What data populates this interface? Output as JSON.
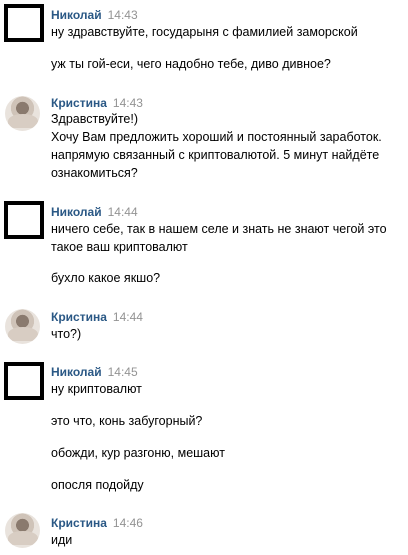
{
  "messages": [
    {
      "author": "Николай",
      "time": "14:43",
      "avatar": "blank-square-avatar",
      "lines": [
        "ну здравствуйте, государыня с фамилией заморской",
        "уж ты гой-еси, чего надобно тебе, диво дивное?"
      ]
    },
    {
      "author": "Кристина",
      "time": "14:43",
      "avatar": "photo-avatar",
      "lines": [
        "Здравствуйте!)",
        "Хочу Вам предложить хороший и постоянный заработок.",
        "напрямую связанный с криптовалютой. 5 минут найдёте",
        "ознакомиться?"
      ]
    },
    {
      "author": "Николай",
      "time": "14:44",
      "avatar": "blank-square-avatar",
      "lines": [
        "ничего себе, так в нашем селе и знать не знают чегой это",
        "такое ваш криптовалют",
        "бухло какое якшо?"
      ]
    },
    {
      "author": "Кристина",
      "time": "14:44",
      "avatar": "photo-avatar",
      "lines": [
        "что?)"
      ]
    },
    {
      "author": "Николай",
      "time": "14:45",
      "avatar": "blank-square-avatar",
      "lines": [
        "ну криптовалют",
        "это что, конь забугорный?",
        "обожди, кур разгоню, мешают",
        "опосля подойду"
      ]
    },
    {
      "author": "Кристина",
      "time": "14:46",
      "avatar": "photo-avatar",
      "lines": [
        "иди"
      ]
    }
  ]
}
